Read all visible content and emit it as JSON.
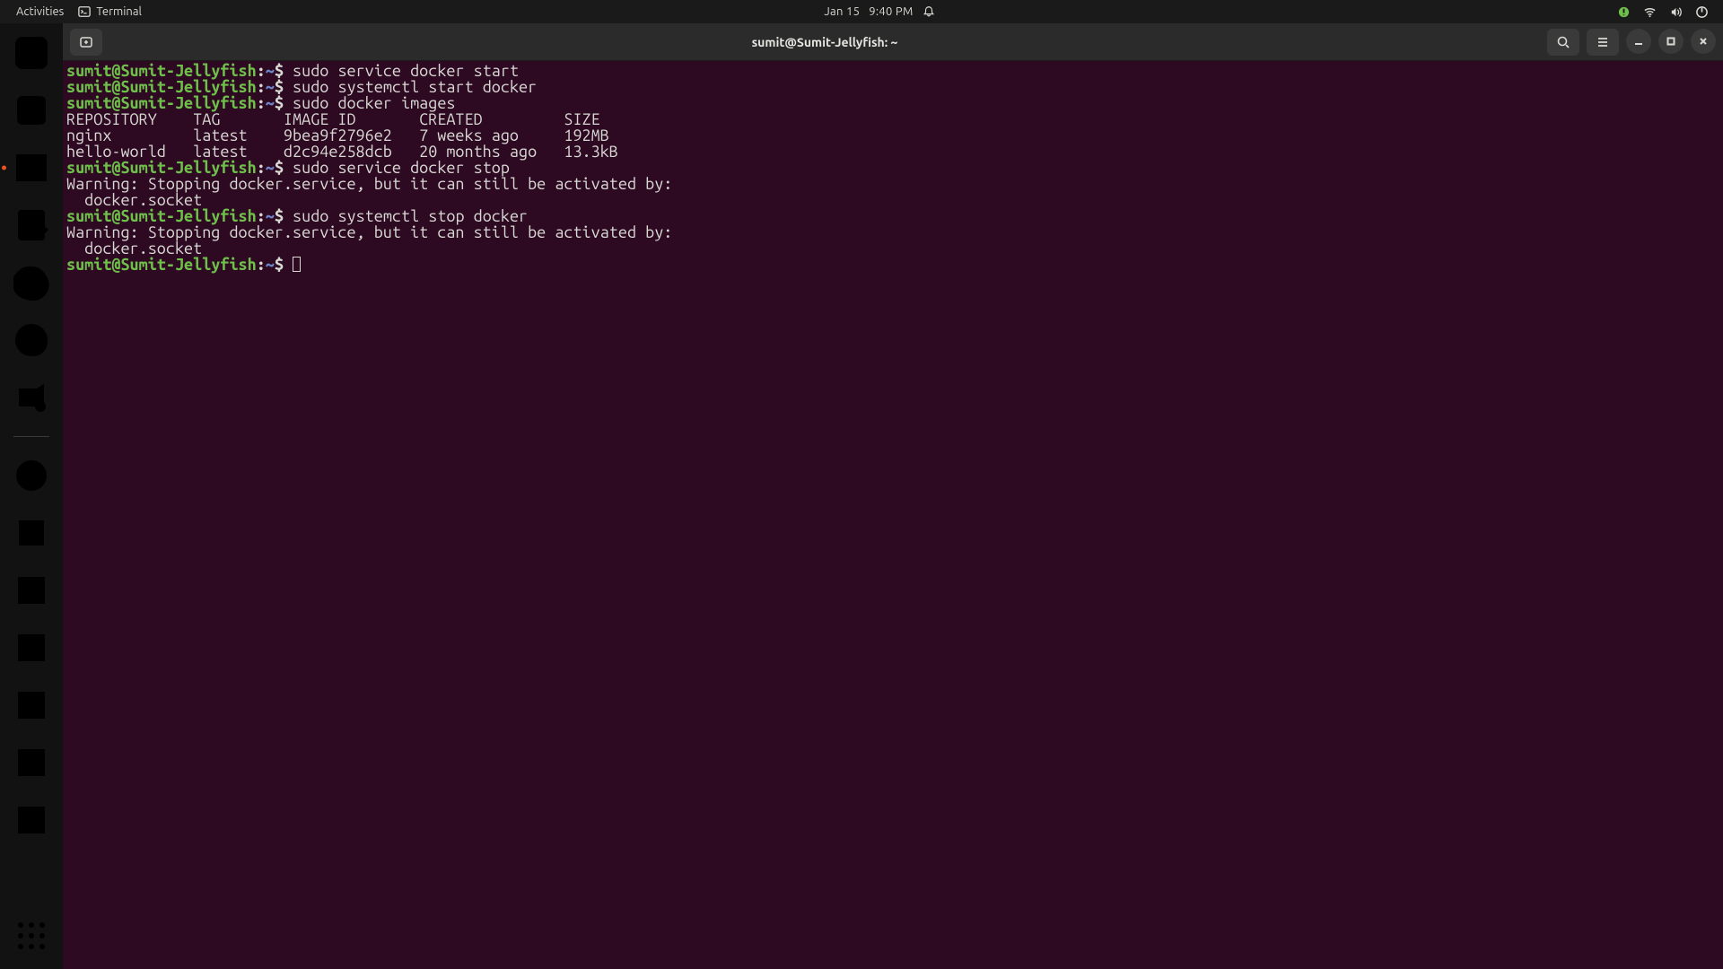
{
  "topbar": {
    "activities_label": "Activities",
    "app_name": "Terminal",
    "date": "Jan 15",
    "time": "9:40 PM"
  },
  "window": {
    "title": "sumit@Sumit-Jellyfish: ~"
  },
  "terminal": {
    "prompt": {
      "userhost": "sumit@Sumit-Jellyfish",
      "colon": ":",
      "path": "~",
      "sigil": "$ "
    },
    "lines": [
      {
        "type": "cmd",
        "text": "sudo service docker start"
      },
      {
        "type": "cmd",
        "text": "sudo systemctl start docker"
      },
      {
        "type": "cmd",
        "text": "sudo docker images"
      },
      {
        "type": "out",
        "text": "REPOSITORY    TAG       IMAGE ID       CREATED         SIZE"
      },
      {
        "type": "out",
        "text": "nginx         latest    9bea9f2796e2   7 weeks ago     192MB"
      },
      {
        "type": "out",
        "text": "hello-world   latest    d2c94e258dcb   20 months ago   13.3kB"
      },
      {
        "type": "cmd",
        "text": "sudo service docker stop"
      },
      {
        "type": "out",
        "text": "Warning: Stopping docker.service, but it can still be activated by:"
      },
      {
        "type": "out",
        "text": "  docker.socket"
      },
      {
        "type": "cmd",
        "text": "sudo systemctl stop docker"
      },
      {
        "type": "out",
        "text": "Warning: Stopping docker.service, but it can still be activated by:"
      },
      {
        "type": "out",
        "text": "  docker.socket"
      },
      {
        "type": "prompt_cursor"
      }
    ]
  },
  "dock": [
    {
      "name": "rhythmbox"
    },
    {
      "name": "files"
    },
    {
      "name": "terminal",
      "active": true
    },
    {
      "name": "text-editor"
    },
    {
      "name": "chrome"
    },
    {
      "name": "firefox"
    },
    {
      "name": "video"
    },
    {
      "sep": true
    },
    {
      "name": "cd"
    },
    {
      "name": "usb"
    },
    {
      "name": "disk"
    },
    {
      "name": "disk"
    },
    {
      "name": "disk"
    },
    {
      "name": "disk"
    },
    {
      "name": "disk"
    }
  ]
}
